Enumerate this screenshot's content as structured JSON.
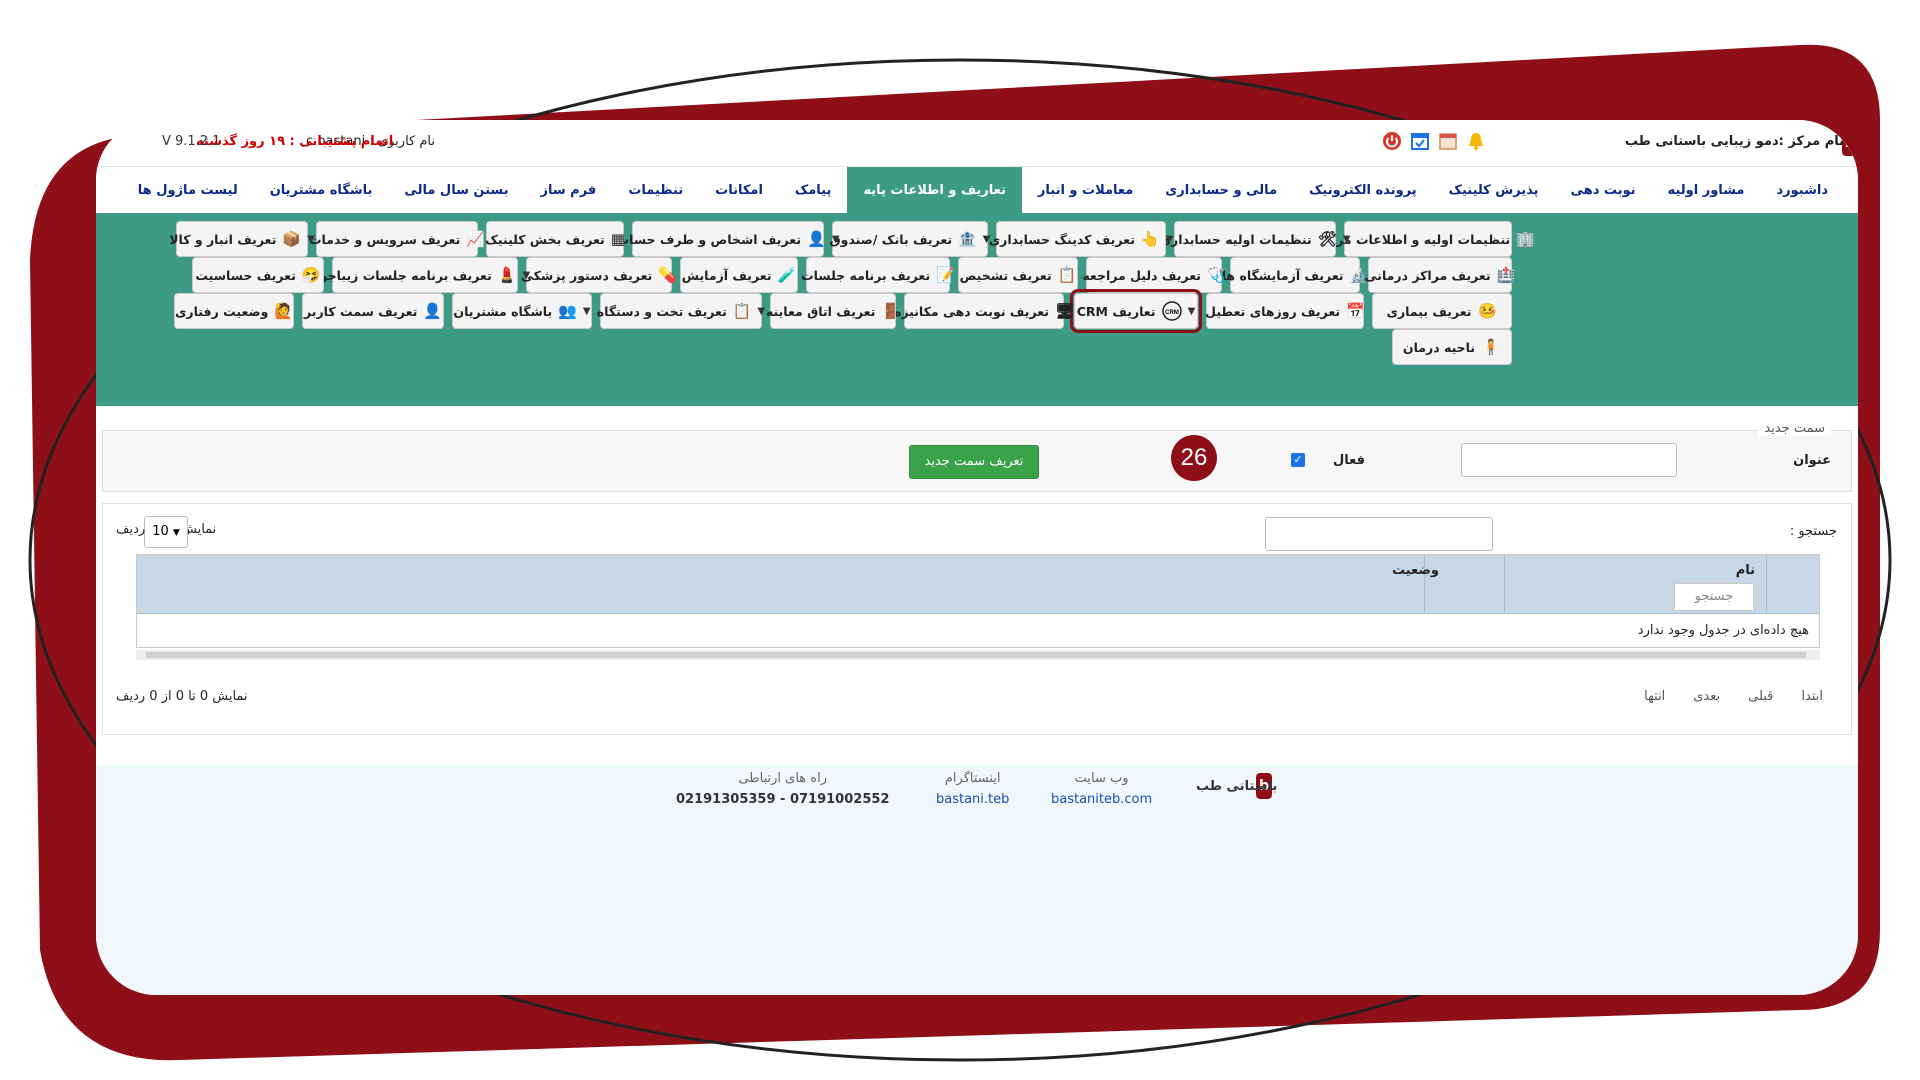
{
  "topbar": {
    "center_name": "نام مرکز :دمو زیبایی باستانی طب",
    "user": "نام کاربری : c.bastani",
    "support": "اتمام پشتیبانی : ۱۹ روز گذشته",
    "version": "V 9.1.2.1",
    "brand_letter": "b"
  },
  "nav": [
    {
      "label": "داشبورد"
    },
    {
      "label": "مشاور اولیه"
    },
    {
      "label": "نوبت دهی"
    },
    {
      "label": "پذیرش کلینیک"
    },
    {
      "label": "پرونده الکترونیک"
    },
    {
      "label": "مالی و حسابداری"
    },
    {
      "label": "معاملات و انبار"
    },
    {
      "label": "تعاریف و اطلاعات پایه"
    },
    {
      "label": "پیامک"
    },
    {
      "label": "امکانات"
    },
    {
      "label": "تنظیمات"
    },
    {
      "label": "فرم ساز"
    },
    {
      "label": "بستن سال مالی"
    },
    {
      "label": "باشگاه مشتریان"
    },
    {
      "label": "لیست ماژول ها"
    }
  ],
  "ribbon": {
    "row1": [
      "تنظیمات اولیه و اطلاعات مرکز",
      "تنظیمات اولیه حسابداری",
      "تعریف کدینگ حسابداری",
      "تعریف بانک /صندوق",
      "تعریف اشخاص و طرف حساب",
      "تعریف بخش کلینیک",
      "تعریف سرویس و خدمات",
      "تعریف انبار و کالا"
    ],
    "row2": [
      "تعریف مراکز درمانی",
      "تعریف آزمایشگاه ها",
      "تعریف دلیل مراجعه",
      "تعریف تشخیص",
      "تعریف برنامه جلسات",
      "تعریف آزمایش",
      "تعریف دستور پزشکی",
      "تعریف برنامه جلسات زیباجو",
      "تعریف حساسیت"
    ],
    "row3": [
      "تعریف بیماری",
      "تعریف روزهای تعطیل",
      "تعاریف CRM",
      "تعریف نوبت دهی مکانیزه",
      "تعریف اتاق معاینه",
      "تعریف تخت و دستگاه",
      "باشگاه مشتریان",
      "تعریف سمت کاربر",
      "وضعیت رفتاری"
    ],
    "row4": [
      "ناحیه درمان"
    ]
  },
  "form": {
    "legend": "سمت جدید",
    "title_label": "عنوان",
    "active_label": "فعال",
    "active_checked": true,
    "step_badge": "26",
    "submit_label": "تعریف سمت جدید"
  },
  "table": {
    "search_label": "جستجو :",
    "show_label": "نمایش",
    "page_length": "10",
    "rows_label": "ردیف",
    "columns": [
      "نام",
      "وضعیت"
    ],
    "column_search_placeholder": "جستجو",
    "empty_text": "هیچ داده‌ای در جدول وجود ندارد",
    "info": "نمایش 0 تا 0 از 0 ردیف",
    "pager": [
      "ابتدا",
      "قبلی",
      "بعدی",
      "انتها"
    ]
  },
  "footer": {
    "brand": "باستانی طب",
    "website_label": "وب سایت",
    "website": "bastaniteb.com",
    "instagram_label": "اینستاگرام",
    "instagram": "bastani.teb",
    "contact_label": "راه های ارتباطی",
    "contact": "07191002552 - 02191305359"
  },
  "colors": {
    "brand": "#8e0f17",
    "ribbon": "#3d9a84",
    "nav_text": "#0a2a8a",
    "primary_button": "#3aa34a"
  }
}
